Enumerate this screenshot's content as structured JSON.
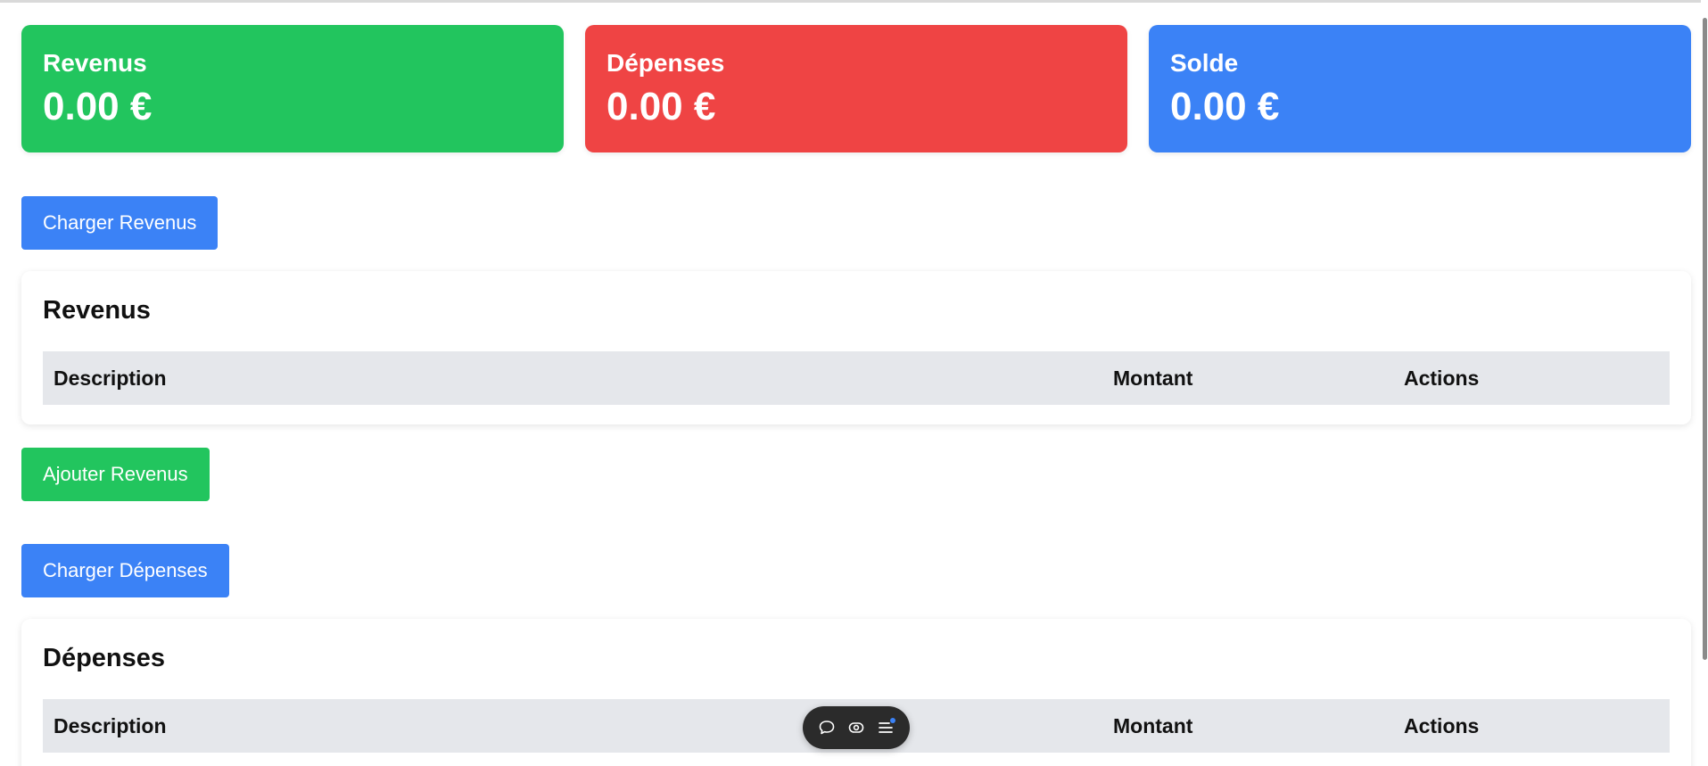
{
  "summary": {
    "revenus": {
      "label": "Revenus",
      "value": "0.00 €",
      "color": "#22c55e"
    },
    "depenses": {
      "label": "Dépenses",
      "value": "0.00 €",
      "color": "#ef4444"
    },
    "solde": {
      "label": "Solde",
      "value": "0.00 €",
      "color": "#3b82f6"
    }
  },
  "buttons": {
    "charger_revenus": "Charger Revenus",
    "ajouter_revenus": "Ajouter Revenus",
    "charger_depenses": "Charger Dépenses"
  },
  "revenus_table": {
    "title": "Revenus",
    "columns": [
      "Description",
      "Montant",
      "Actions"
    ]
  },
  "depenses_table": {
    "title": "Dépenses",
    "columns": [
      "Description",
      "Montant",
      "Actions"
    ]
  },
  "floating_toolbar": {
    "icons": [
      "chat-bubble-icon",
      "eye-icon",
      "menu-list-icon"
    ]
  }
}
